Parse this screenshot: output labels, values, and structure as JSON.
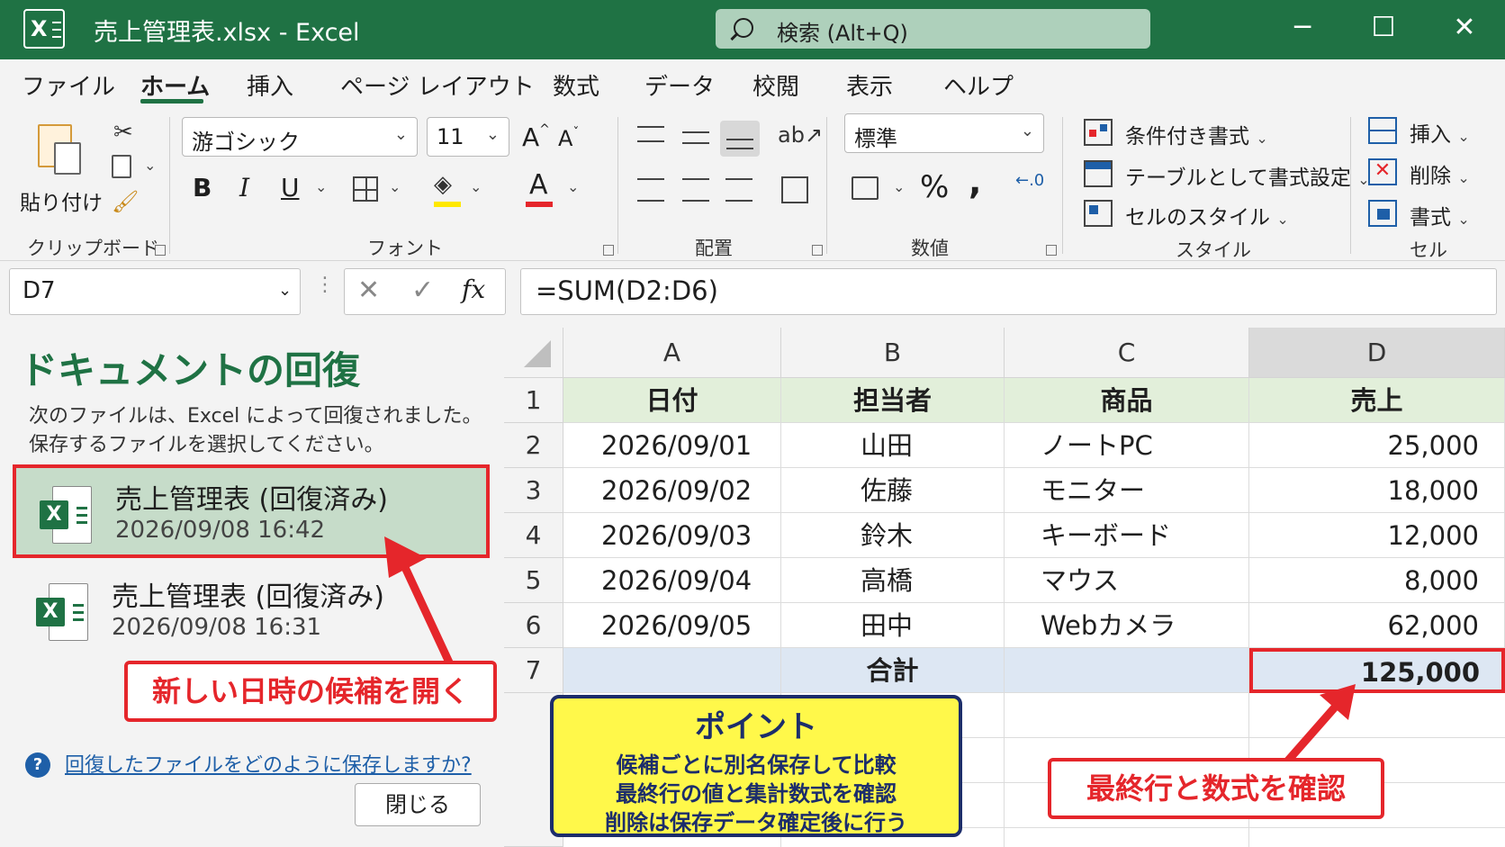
{
  "window": {
    "app_icon_letter": "X",
    "title": "売上管理表.xlsx  -  Excel",
    "search_placeholder": "検索 (Alt+Q)",
    "minimize": "─",
    "maximize": "☐",
    "close": "✕"
  },
  "tabs": [
    "ファイル",
    "ホーム",
    "挿入",
    "ページ レイアウト",
    "数式",
    "データ",
    "校閲",
    "表示",
    "ヘルプ"
  ],
  "ribbon": {
    "clipboard": {
      "paste_label": "貼り付け",
      "group_label": "クリップボード"
    },
    "font": {
      "font_name": "游ゴシック",
      "font_size": "11",
      "grow": "A",
      "shrink": "A",
      "bold": "B",
      "italic": "I",
      "underline": "U",
      "font_color_letter": "A",
      "group_label": "フォント"
    },
    "alignment": {
      "group_label": "配置"
    },
    "number": {
      "format": "標準",
      "percent": "%",
      "comma": ",",
      "group_label": "数値"
    },
    "styles": {
      "conditional": "条件付き書式",
      "as_table": "テーブルとして書式設定",
      "cell_styles": "セルのスタイル",
      "group_label": "スタイル"
    },
    "cells": {
      "insert": "挿入",
      "delete": "削除",
      "format": "書式",
      "group_label": "セル"
    }
  },
  "formula_bar": {
    "name_box": "D7",
    "fx": "fx",
    "formula": "=SUM(D2:D6)"
  },
  "recovery_pane": {
    "title": "ドキュメントの回復",
    "desc_line1": "次のファイルは、Excel によって回復されました。",
    "desc_line2": "保存するファイルを選択してください。",
    "files": [
      {
        "name": "売上管理表 (回復済み)",
        "time": "2026/09/08 16:42"
      },
      {
        "name": "売上管理表 (回復済み)",
        "time": "2026/09/08 16:31"
      }
    ],
    "help_link": "回復したファイルをどのように保存しますか?",
    "close_button": "閉じる"
  },
  "sheet": {
    "columns": [
      "A",
      "B",
      "C",
      "D"
    ],
    "rows": [
      "1",
      "2",
      "3",
      "4",
      "5",
      "6",
      "7"
    ],
    "header": [
      "日付",
      "担当者",
      "商品",
      "売上"
    ],
    "data": [
      [
        "2026/09/01",
        "山田",
        "ノートPC",
        "25,000"
      ],
      [
        "2026/09/02",
        "佐藤",
        "モニター",
        "18,000"
      ],
      [
        "2026/09/03",
        "鈴木",
        "キーボード",
        "12,000"
      ],
      [
        "2026/09/04",
        "高橋",
        "マウス",
        "8,000"
      ],
      [
        "2026/09/05",
        "田中",
        "Webカメラ",
        "62,000"
      ]
    ],
    "total_label": "合計",
    "total_value": "125,000"
  },
  "annotations": {
    "open_newest": "新しい日時の候補を開く",
    "point_title": "ポイント",
    "point_lines": [
      "候補ごとに別名保存して比較",
      "最終行の値と集計数式を確認",
      "削除は保存データ確定後に行う"
    ],
    "check_last_row": "最終行と数式を確認"
  },
  "colors": {
    "excel_green": "#1f7244",
    "callout_red": "#e5262b",
    "point_yellow": "#fff84a",
    "point_navy": "#1c2d6b"
  }
}
